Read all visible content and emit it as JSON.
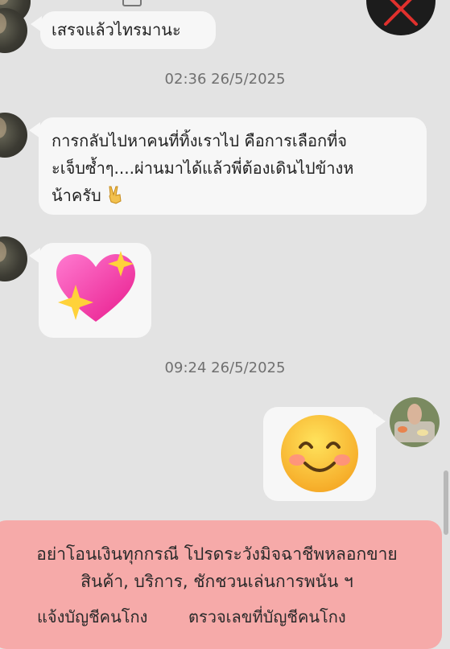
{
  "messages": [
    {
      "text": "เสรจแล้วไทรมานะ"
    },
    {
      "text_line1": "การกลับไปหาคนที่ทิ้งเราไป คือการเลือกที่จ",
      "text_line2": "ะเจ็บซ้ำๆ....ผ่านมาได้แล้วพี่ต้องเดินไปข้างห",
      "text_line3": "น้าครับ"
    },
    {
      "emoji": "sparkling-heart"
    },
    {
      "emoji": "smiling-face"
    }
  ],
  "timestamps": [
    "02:36 26/5/2025",
    "09:24 26/5/2025"
  ],
  "warning": {
    "line1": "อย่าโอนเงินทุกกรณี โปรดระวังมิจฉาชีพหลอกขาย",
    "line2": "สินค้า, บริการ, ชักชวนเล่นการพนัน ฯ",
    "report_link": "แจ้งบัญชีคนโกง",
    "check_link": "ตรวจเลขที่บัญชีคนโกง"
  },
  "colors": {
    "background": "#e3e3e3",
    "bubble": "#f7f7f7",
    "warning": "#f6aaa9",
    "close_icon": "#e0302d"
  },
  "icons": [
    "close-icon",
    "victory-hand-icon",
    "sparkling-heart-emoji",
    "smiling-face-emoji"
  ]
}
